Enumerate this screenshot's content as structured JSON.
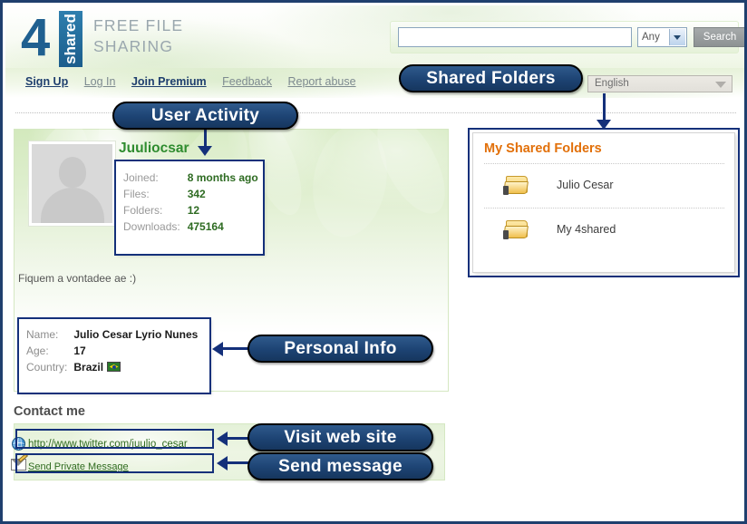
{
  "site": {
    "logo_char": "4",
    "logo_word": "shared",
    "tagline_line1": "FREE FILE",
    "tagline_line2": "SHARING"
  },
  "search": {
    "value": "",
    "placeholder": "",
    "type_selected": "Any",
    "button_label": "Search"
  },
  "nav": {
    "items": [
      {
        "label": "Sign Up",
        "style": "strong"
      },
      {
        "label": "Log In",
        "style": "dim"
      },
      {
        "label": "Join Premium",
        "style": "strong"
      },
      {
        "label": "Feedback",
        "style": "dim"
      },
      {
        "label": "Report abuse",
        "style": "dim"
      }
    ],
    "language_selected": "English"
  },
  "profile": {
    "username": "Juuliocsar",
    "bio": "Fiquem a vontadee ae :)",
    "stats": [
      {
        "key": "Joined:",
        "value": "8 months ago"
      },
      {
        "key": "Files:",
        "value": "342"
      },
      {
        "key": "Folders:",
        "value": "12"
      },
      {
        "key": "Downloads:",
        "value": "475164"
      }
    ],
    "personal": [
      {
        "key": "Name:",
        "value": "Julio Cesar Lyrio Nunes"
      },
      {
        "key": "Age:",
        "value": "17"
      },
      {
        "key": "Country:",
        "value": "Brazil"
      }
    ]
  },
  "contact": {
    "title": "Contact me",
    "website_url": "http://www.twitter.com/juulio_cesar",
    "message_label": "Send Private Message"
  },
  "folders": {
    "title": "My Shared Folders",
    "items": [
      {
        "name": "Julio Cesar"
      },
      {
        "name": "My 4shared"
      }
    ]
  },
  "callouts": {
    "shared_folders": "Shared Folders",
    "user_activity": "User Activity",
    "personal_info": "Personal Info",
    "visit_web_site": "Visit web site",
    "send_message": "Send message"
  },
  "colors": {
    "brand_blue": "#1f6090",
    "annotation": "#14307a",
    "username_green": "#2f8c2f",
    "folders_orange": "#e2700a"
  }
}
